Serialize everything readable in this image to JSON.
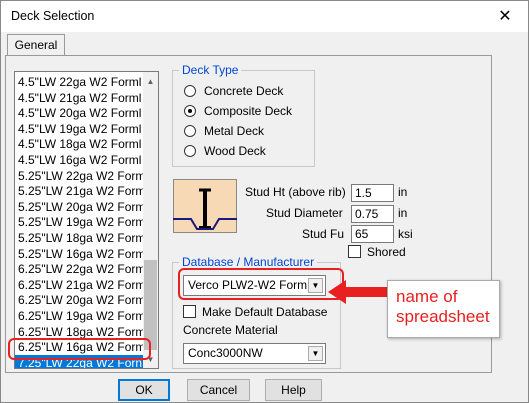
{
  "window": {
    "title": "Deck Selection",
    "close_glyph": "✕"
  },
  "tabs": [
    {
      "label": "General"
    }
  ],
  "deck_list": {
    "items": [
      "4.5\"LW 22ga W2 Forml",
      "4.5\"LW 21ga W2 Forml",
      "4.5\"LW 20ga W2 Forml",
      "4.5\"LW 19ga W2 Forml",
      "4.5\"LW 18ga W2 Forml",
      "4.5\"LW 16ga W2 Forml",
      "5.25\"LW 22ga W2 Form",
      "5.25\"LW 21ga W2 Form",
      "5.25\"LW 20ga W2 Form",
      "5.25\"LW 19ga W2 Form",
      "5.25\"LW 18ga W2 Form",
      "5.25\"LW 16ga W2 Form",
      "6.25\"LW 22ga W2 Form",
      "6.25\"LW 21ga W2 Form",
      "6.25\"LW 20ga W2 Form",
      "6.25\"LW 19ga W2 Form",
      "6.25\"LW 18ga W2 Form",
      "6.25\"LW 16ga W2 Form",
      "7.25\"LW 22ga W2 Forn"
    ],
    "selected_index": 18
  },
  "deck_type": {
    "legend": "Deck Type",
    "options": [
      "Concrete Deck",
      "Composite Deck",
      "Metal Deck",
      "Wood Deck"
    ],
    "selected": "Composite Deck"
  },
  "stud": {
    "ht_label": "Stud Ht (above rib)",
    "ht_value": "1.5",
    "ht_unit": "in",
    "dia_label": "Stud Diameter",
    "dia_value": "0.75",
    "dia_unit": "in",
    "fu_label": "Stud Fu",
    "fu_value": "65",
    "fu_unit": "ksi",
    "shored_label": "Shored",
    "shored_checked": false
  },
  "database": {
    "legend": "Database / Manufacturer",
    "selected": "Verco PLW2-W2 Form",
    "make_default_label": "Make Default Database",
    "make_default_checked": false,
    "material_label": "Concrete Material",
    "material_selected": "Conc3000NW"
  },
  "buttons": {
    "ok": "OK",
    "cancel": "Cancel",
    "help": "Help"
  },
  "annotation": {
    "line1": "name of",
    "line2": "spreadsheet",
    "color": "#e82020"
  },
  "colors": {
    "selection": "#0078d7",
    "group_legend": "#0046d5",
    "deck_fill": "#f7d9b5"
  }
}
